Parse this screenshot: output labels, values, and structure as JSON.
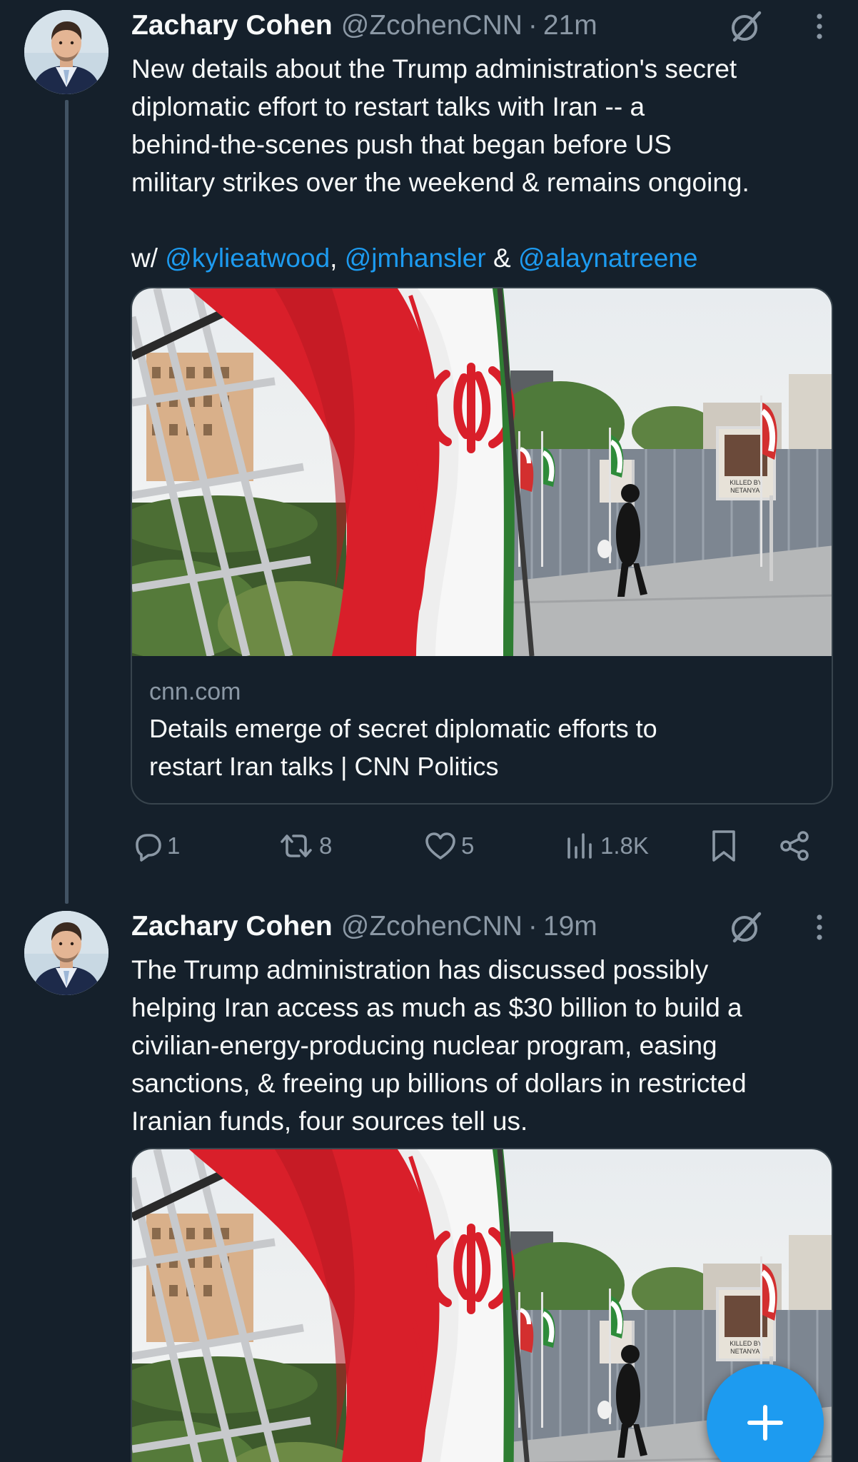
{
  "tweets": [
    {
      "author_name": "Zachary Cohen",
      "handle": "@ZcohenCNN",
      "separator": "·",
      "time": "21m",
      "lines": [
        "New details about the Trump administration's secret",
        "diplomatic effort to restart talks with Iran -- a",
        "behind-the-scenes push that began before US",
        "military strikes over the weekend & remains ongoing."
      ],
      "mentions_prefix": "w/ ",
      "mention_1": "@kylieatwood",
      "comma": ", ",
      "mention_2": "@jmhansler",
      "amp": " & ",
      "mention_3": "@alaynatreene",
      "card": {
        "domain": "cnn.com",
        "title_line_1": "Details emerge of secret diplomatic efforts to",
        "title_line_2": "restart Iran talks | CNN Politics",
        "poster_text_1": "KILLED BY",
        "poster_text_2": "NETANYAI"
      },
      "stats": {
        "replies": "1",
        "reposts": "8",
        "likes": "5",
        "views": "1.8K"
      }
    },
    {
      "author_name": "Zachary Cohen",
      "handle": "@ZcohenCNN",
      "separator": "·",
      "time": "19m",
      "lines": [
        "The Trump administration has discussed possibly",
        "helping Iran access as much as $30 billion to build a",
        "civilian-energy-producing nuclear program, easing",
        "sanctions, & freeing up billions of dollars in restricted",
        "Iranian funds, four sources tell us."
      ],
      "card": {
        "poster_text_1": "KILLED BY",
        "poster_text_2": "NETANYAI"
      }
    }
  ],
  "icons": {
    "grok": "grok-icon",
    "more": "more-options-icon",
    "reply": "reply-icon",
    "repost": "repost-icon",
    "like": "heart-icon",
    "views": "views-icon",
    "bookmark": "bookmark-icon",
    "share": "share-icon",
    "compose": "plus-icon"
  },
  "colors": {
    "background": "#15202b",
    "text": "#f7f9f9",
    "muted": "#8b98a5",
    "link": "#1d9bf0",
    "thread_line": "#425364",
    "fab": "#1d9bf0"
  }
}
